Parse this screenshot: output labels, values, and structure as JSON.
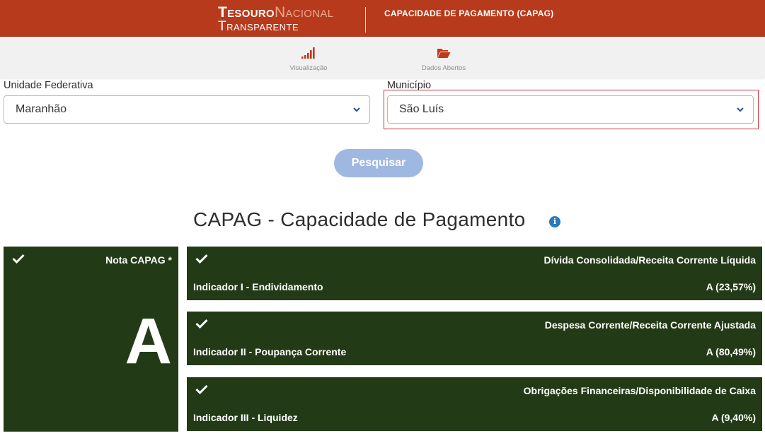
{
  "header": {
    "logo_part1": "Tesouro",
    "logo_part2": "Nacional",
    "logo_part3": "Transparente",
    "app_title": "CAPACIDADE DE PAGAMENTO (CAPAG)"
  },
  "nav": {
    "items": [
      {
        "label": "Visualização",
        "icon": "bar-signal-icon"
      },
      {
        "label": "Dados Abertos",
        "icon": "folder-open-icon"
      }
    ]
  },
  "form": {
    "uf_label": "Unidade Federativa",
    "uf_value": "Maranhão",
    "mun_label": "Município",
    "mun_value": "São Luís",
    "search_button": "Pesquisar"
  },
  "main": {
    "title": "CAPAG - Capacidade de Pagamento",
    "info_icon": "i"
  },
  "nota": {
    "title": "Nota CAPAG *",
    "grade": "A"
  },
  "indicators": [
    {
      "right_title": "Dívida Consolidada/Receita Corrente Líquida",
      "name": "Indicador I - Endividamento",
      "score": "A (23,57%)"
    },
    {
      "right_title": "Despesa Corrente/Receita Corrente Ajustada",
      "name": "Indicador II - Poupança Corrente",
      "score": "A (80,49%)"
    },
    {
      "right_title": "Obrigações Financeiras/Disponibilidade de Caixa",
      "name": "Indicador III - Liquidez",
      "score": "A (9,40%)"
    }
  ],
  "colors": {
    "header_bg": "#b83a1c",
    "card_bg": "#223b16",
    "button_bg": "#9fb8e1",
    "highlight": "#c8343c",
    "nav_icon": "#c0391b"
  }
}
